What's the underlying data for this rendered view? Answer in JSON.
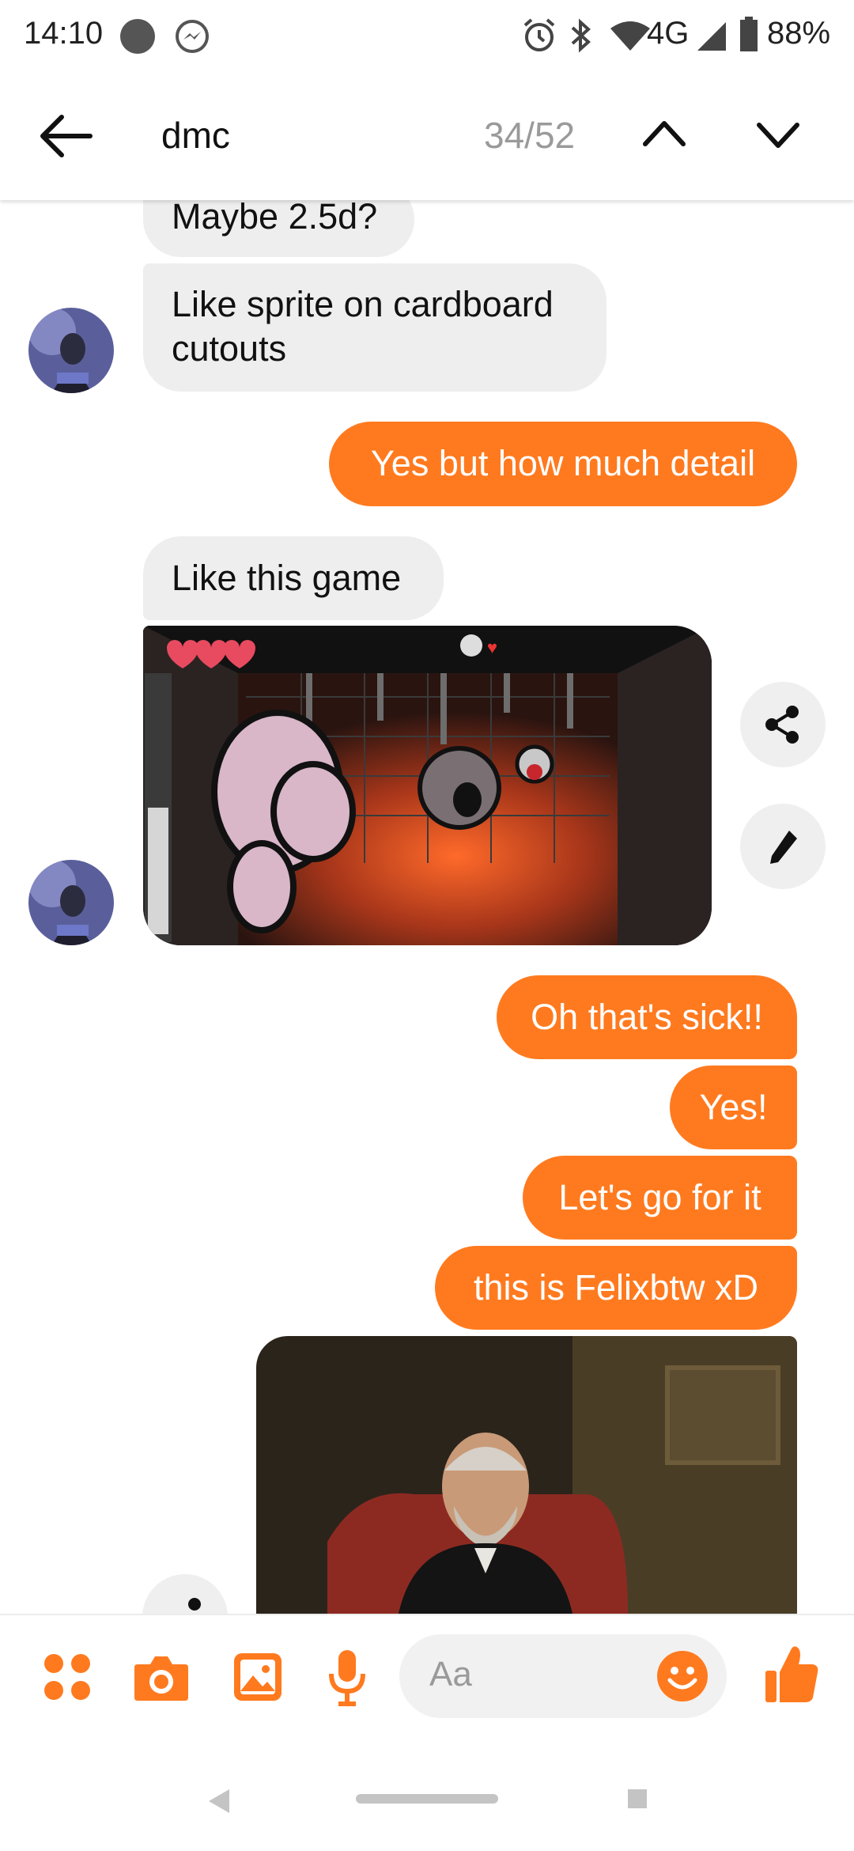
{
  "status_bar": {
    "time": "14:10",
    "network": "4G",
    "battery": "88%",
    "icons": [
      "status-dot-icon",
      "messenger-icon",
      "alarm-icon",
      "bluetooth-icon",
      "wifi-icon",
      "signal-icon",
      "battery-icon"
    ]
  },
  "header": {
    "back_icon": "back-arrow-icon",
    "search_query": "dmc",
    "result_counter": "34/52",
    "prev_icon": "chevron-up-icon",
    "next_icon": "chevron-down-icon"
  },
  "messages": [
    {
      "direction": "in",
      "text": "Maybe 2.5d?"
    },
    {
      "direction": "in",
      "lines": [
        "Like sprite on cardboard",
        "cutouts"
      ]
    },
    {
      "direction": "out",
      "text": "Yes but how much detail"
    },
    {
      "direction": "in",
      "text": "Like this game"
    },
    {
      "direction": "in",
      "type": "image",
      "content": "game-screenshot"
    },
    {
      "direction": "out",
      "text": "Oh that's sick!!"
    },
    {
      "direction": "out",
      "text": "Yes!"
    },
    {
      "direction": "out",
      "text": "Let's go for it"
    },
    {
      "direction": "out",
      "text": "this is Felixbtw xD"
    },
    {
      "direction": "out",
      "type": "image",
      "content": "portrait-painting"
    }
  ],
  "image_actions": {
    "share_icon": "share-icon",
    "edit_icon": "pencil-icon"
  },
  "composer": {
    "placeholder": "Aa",
    "icons": [
      "apps-grid-icon",
      "camera-icon",
      "gallery-icon",
      "microphone-icon",
      "emoji-icon",
      "thumbs-up-icon"
    ]
  },
  "colors": {
    "accent": "#ff7a1f",
    "incoming_bubble": "#eeeeee",
    "outgoing_text": "#ffffff"
  },
  "nav_bar": {
    "icons": [
      "nav-back-icon",
      "home-pill-icon",
      "recents-icon"
    ]
  }
}
